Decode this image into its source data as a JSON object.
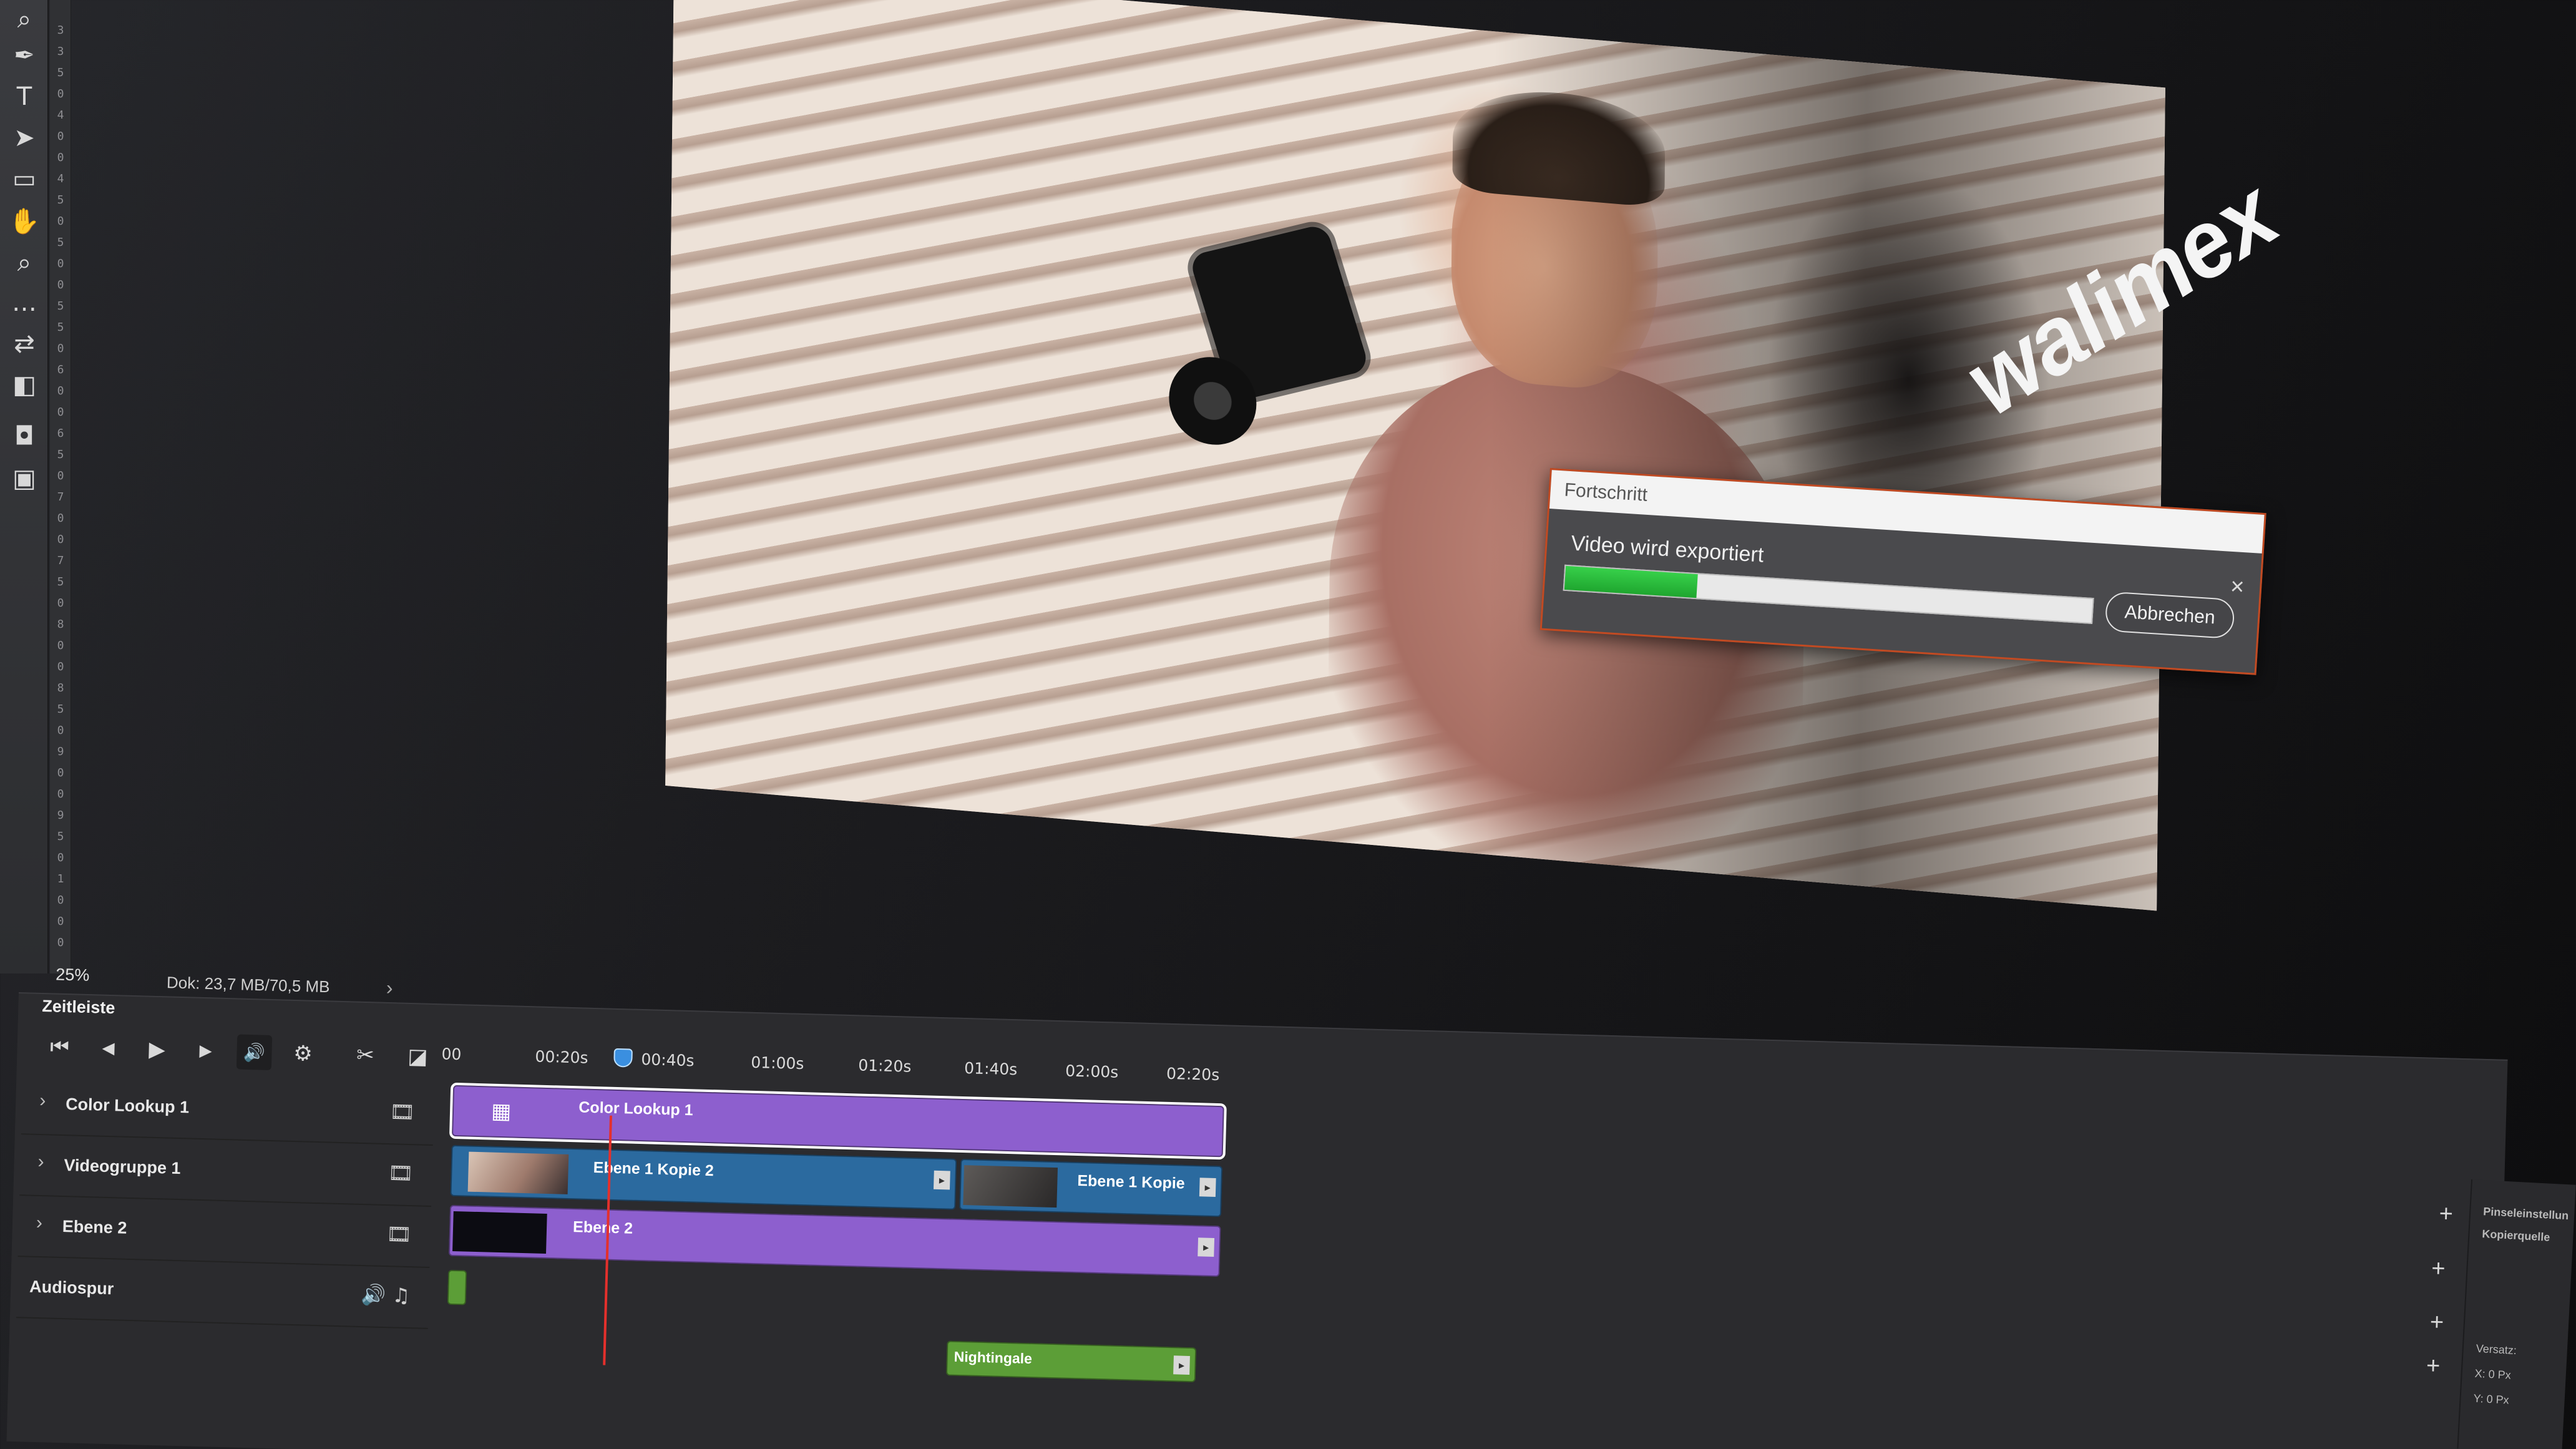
{
  "toolbar": {
    "tools": [
      {
        "icon": "zoom-search-icon",
        "glyph": "⌕"
      },
      {
        "icon": "pen-tool-icon",
        "glyph": "✒"
      },
      {
        "icon": "type-tool-icon",
        "glyph": "T"
      },
      {
        "icon": "path-selection-icon",
        "glyph": "➤"
      },
      {
        "icon": "rectangle-tool-icon",
        "glyph": "▭"
      },
      {
        "icon": "hand-tool-icon",
        "glyph": "✋"
      },
      {
        "icon": "zoom-tool-icon",
        "glyph": "⌕"
      },
      {
        "icon": "more-tools-icon",
        "glyph": "…"
      },
      {
        "icon": "swap-colors-icon",
        "glyph": "⇄"
      },
      {
        "icon": "foreground-background-color-icon",
        "glyph": "◧"
      },
      {
        "icon": "quick-mask-icon",
        "glyph": "◘"
      },
      {
        "icon": "screen-mode-icon",
        "glyph": "▣"
      }
    ],
    "ruler_marks": [
      "3",
      "3",
      "5",
      "0",
      "4",
      "0",
      "0",
      "4",
      "5",
      "0",
      "5",
      "0",
      "0",
      "5",
      "5",
      "0",
      "6",
      "0",
      "0",
      "6",
      "5",
      "0",
      "7",
      "0",
      "0",
      "7",
      "5",
      "0",
      "8",
      "0",
      "0",
      "8",
      "5",
      "0",
      "9",
      "0",
      "0",
      "9",
      "5",
      "0",
      "1",
      "0",
      "0",
      "0"
    ]
  },
  "canvas": {
    "brand_text": "walimex"
  },
  "dialog": {
    "title": "Fortschritt",
    "message": "Video wird exportiert",
    "progress": 0.25,
    "cancel_label": "Abbrechen",
    "close_glyph": "×",
    "accent_color": "#c24a22",
    "progress_color": "#2bbd3c"
  },
  "status": {
    "zoom": "25%",
    "doc_size": "Dok: 23,7 MB/70,5 MB",
    "arrow": "›"
  },
  "timeline": {
    "tab_label": "Zeitleiste",
    "controls": [
      {
        "name": "go-to-first-frame-button",
        "glyph": "⏮"
      },
      {
        "name": "previous-frame-button",
        "glyph": "◀"
      },
      {
        "name": "play-button",
        "glyph": "▶"
      },
      {
        "name": "next-frame-button",
        "glyph": "▶"
      },
      {
        "name": "audio-toggle-button",
        "glyph": "🔊"
      },
      {
        "name": "settings-button",
        "glyph": "⚙"
      },
      {
        "name": "split-clip-button",
        "glyph": "✂"
      },
      {
        "name": "transition-button",
        "glyph": "◪"
      }
    ],
    "time_labels": [
      "00",
      "00:20s",
      "00:40s",
      "01:00s",
      "01:20s",
      "01:40s",
      "02:00s",
      "02:20s"
    ],
    "tracks": [
      {
        "name": "Color Lookup 1",
        "chevron": "›",
        "icon": "🎞"
      },
      {
        "name": "Videogruppe 1",
        "chevron": "›",
        "icon": "🎞"
      },
      {
        "name": "Ebene 2",
        "chevron": "›",
        "icon": "🎞"
      },
      {
        "name": "Audiospur",
        "chevron": "",
        "icon": "🔊 ♫"
      }
    ],
    "clips": {
      "color_lookup": "Color Lookup 1",
      "ebene1_kopie2": "Ebene 1 Kopie 2",
      "ebene1_kopie": "Ebene 1 Kopie",
      "ebene2": "Ebene 2",
      "audio": "Nightingale"
    },
    "add_glyph": "+"
  },
  "side_panel": {
    "title": "Pinseleinstellun",
    "subtitle": "Kopierquelle",
    "offset_label": "Versatz:",
    "x_value": "X: 0 Px",
    "y_value": "Y: 0 Px"
  }
}
